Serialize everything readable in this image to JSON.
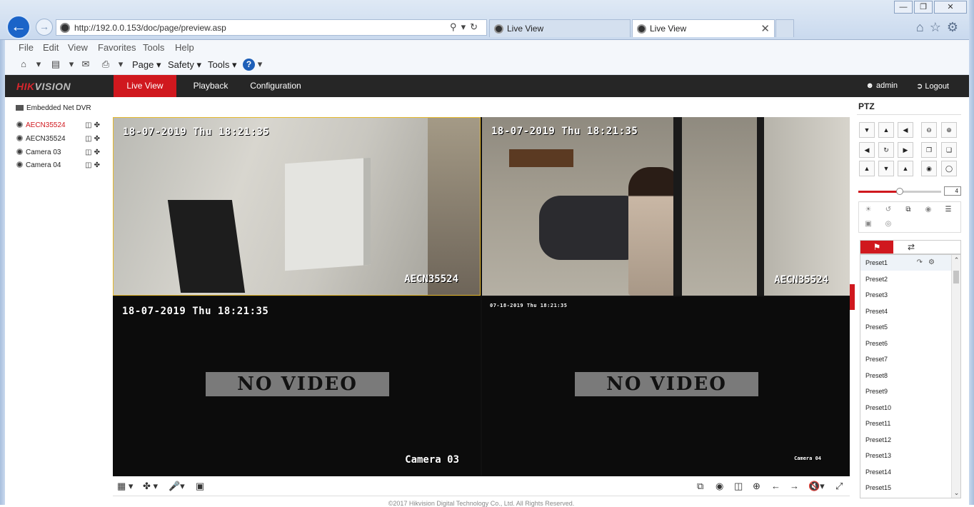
{
  "browser": {
    "url": "http://192.0.0.153/doc/page/preview.asp",
    "tabs": [
      {
        "label": "Live View",
        "active": false
      },
      {
        "label": "Live View",
        "active": true
      }
    ],
    "menu": [
      "File",
      "Edit",
      "View",
      "Favorites",
      "Tools",
      "Help"
    ],
    "commands": {
      "page": "Page",
      "safety": "Safety",
      "tools": "Tools"
    }
  },
  "app": {
    "logo_primary": "HIK",
    "logo_rest": "VISION",
    "nav": [
      {
        "label": "Live View",
        "active": true
      },
      {
        "label": "Playback",
        "active": false
      },
      {
        "label": "Configuration",
        "active": false
      }
    ],
    "user": "admin",
    "logout": "Logout",
    "accent_color": "#d0181e"
  },
  "sidebar": {
    "device": "Embedded Net DVR",
    "cameras": [
      {
        "label": "AECN35524",
        "active": true
      },
      {
        "label": "AECN35524",
        "active": false
      },
      {
        "label": "Camera 03",
        "active": false
      },
      {
        "label": "Camera 04",
        "active": false
      }
    ]
  },
  "panes": [
    {
      "timestamp": "18-07-2019 Thu 18:21:35",
      "name": "AECN35524",
      "selected": true,
      "signal": true
    },
    {
      "timestamp": "18-07-2019 Thu 18:21:35",
      "name": "AECN35524",
      "selected": false,
      "signal": true
    },
    {
      "timestamp": "18-07-2019 Thu 18:21:35",
      "name": "Camera 03",
      "selected": false,
      "signal": false,
      "no_video": "NO VIDEO"
    },
    {
      "timestamp": "07-18-2019 Thu 18:21:35",
      "name": "Camera 04",
      "selected": false,
      "signal": false,
      "no_video": "NO VIDEO"
    }
  ],
  "footer": "©2017 Hikvision Digital Technology Co., Ltd. All Rights Reserved.",
  "ptz": {
    "title": "PTZ",
    "speed": "4",
    "speed_fraction": 0.5,
    "presets": [
      "Preset1",
      "Preset2",
      "Preset3",
      "Preset4",
      "Preset5",
      "Preset6",
      "Preset7",
      "Preset8",
      "Preset9",
      "Preset10",
      "Preset11",
      "Preset12",
      "Preset13",
      "Preset14",
      "Preset15"
    ]
  }
}
